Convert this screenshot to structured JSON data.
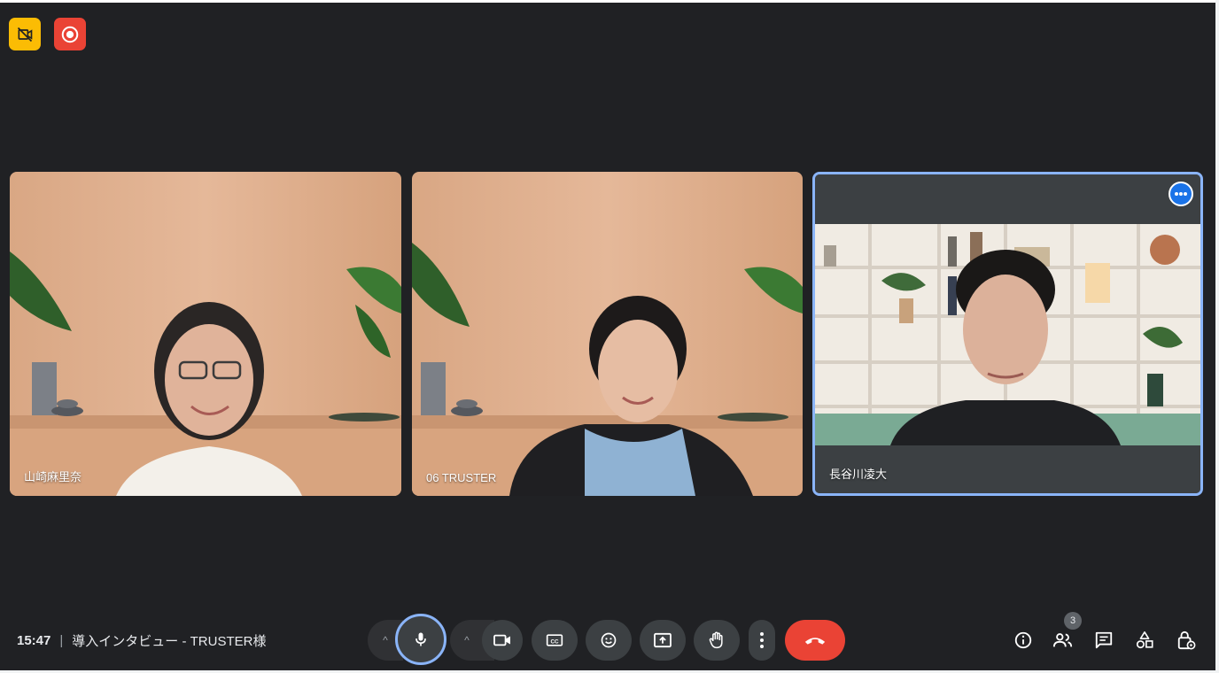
{
  "meeting": {
    "time": "15:47",
    "separator": "|",
    "title": "導入インタビュー - TRUSTER様"
  },
  "participants": [
    {
      "name": "山崎麻里奈",
      "background": "wood-wall"
    },
    {
      "name": "06 TRUSTER",
      "background": "wood-wall"
    },
    {
      "name": "長谷川凌大",
      "background": "bookshelf",
      "active_speaker": true
    }
  ],
  "participant_count": "3",
  "colors": {
    "stage": "#202124",
    "control": "#3c4043",
    "active_outline": "#8ab4f8",
    "hangup": "#ea4335",
    "badge_yellow": "#fbbc04",
    "badge_red": "#ea4335"
  },
  "controls": {
    "left_badges": [
      "video-off-badge-icon",
      "recording-icon"
    ],
    "center": [
      "mic-options-chevron-icon",
      "mic-icon",
      "camera-options-chevron-icon",
      "camera-icon",
      "captions-icon",
      "emoji-icon",
      "present-screen-icon",
      "raise-hand-icon",
      "more-options-icon",
      "hangup-icon"
    ],
    "right": [
      "info-icon",
      "people-icon",
      "chat-icon",
      "activities-icon",
      "host-controls-icon"
    ]
  }
}
